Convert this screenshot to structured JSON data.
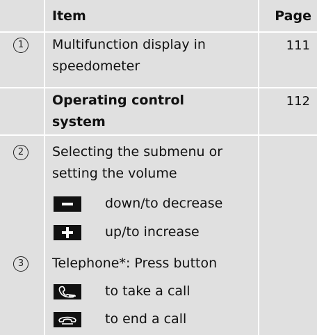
{
  "header": {
    "item": "Item",
    "page": "Page"
  },
  "rows": [
    {
      "num": "1",
      "text_line1": "Multifunction display in",
      "text_line2": "speedometer",
      "page": "111"
    },
    {
      "text_line1": "Operating control",
      "text_line2": "system",
      "page": "112"
    },
    {
      "num": "2",
      "text_line1": "Selecting the submenu or",
      "text_line2": "setting the volume"
    },
    {
      "icon": "minus-button-icon",
      "text": "down/to decrease"
    },
    {
      "icon": "plus-button-icon",
      "text": "up/to increase"
    },
    {
      "num": "3",
      "text": "Telephone*: Press button"
    },
    {
      "icon": "phone-pickup-icon",
      "text": "to take a call"
    },
    {
      "icon": "phone-hangup-icon",
      "text": "to end a call"
    }
  ]
}
